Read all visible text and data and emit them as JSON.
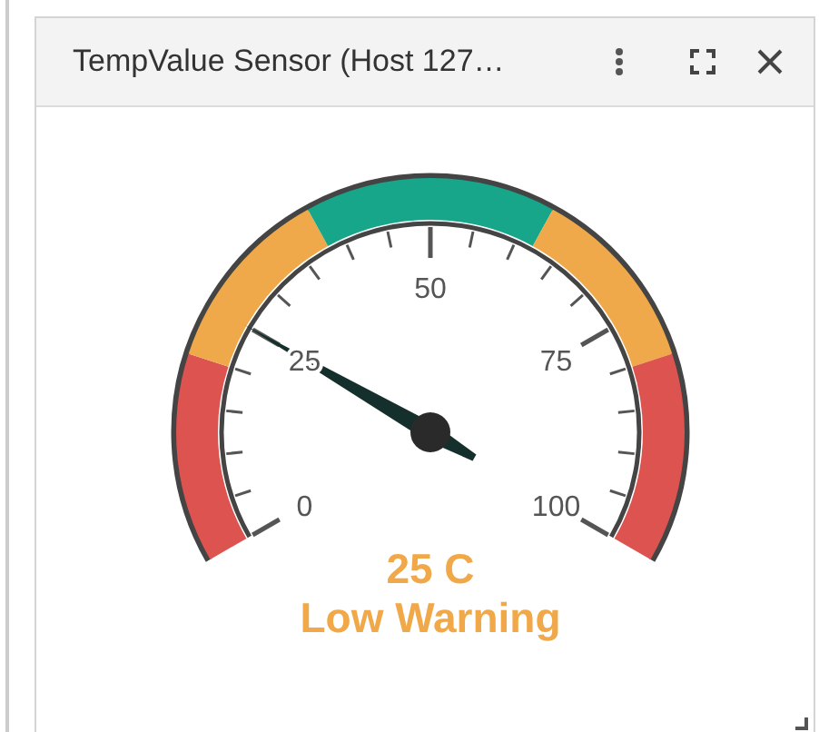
{
  "panel": {
    "title": "TempValue Sensor (Host 127…"
  },
  "gauge": {
    "level": 0.25,
    "reading": "25 C",
    "status": "Low Warning",
    "tick_labels": [
      "0",
      "25",
      "50",
      "75",
      "100"
    ],
    "bands": [
      {
        "color": "#dc5350"
      },
      {
        "color": "#efa94a"
      },
      {
        "color": "#17a689"
      },
      {
        "color": "#efa94a"
      },
      {
        "color": "#dc5350"
      }
    ]
  }
}
